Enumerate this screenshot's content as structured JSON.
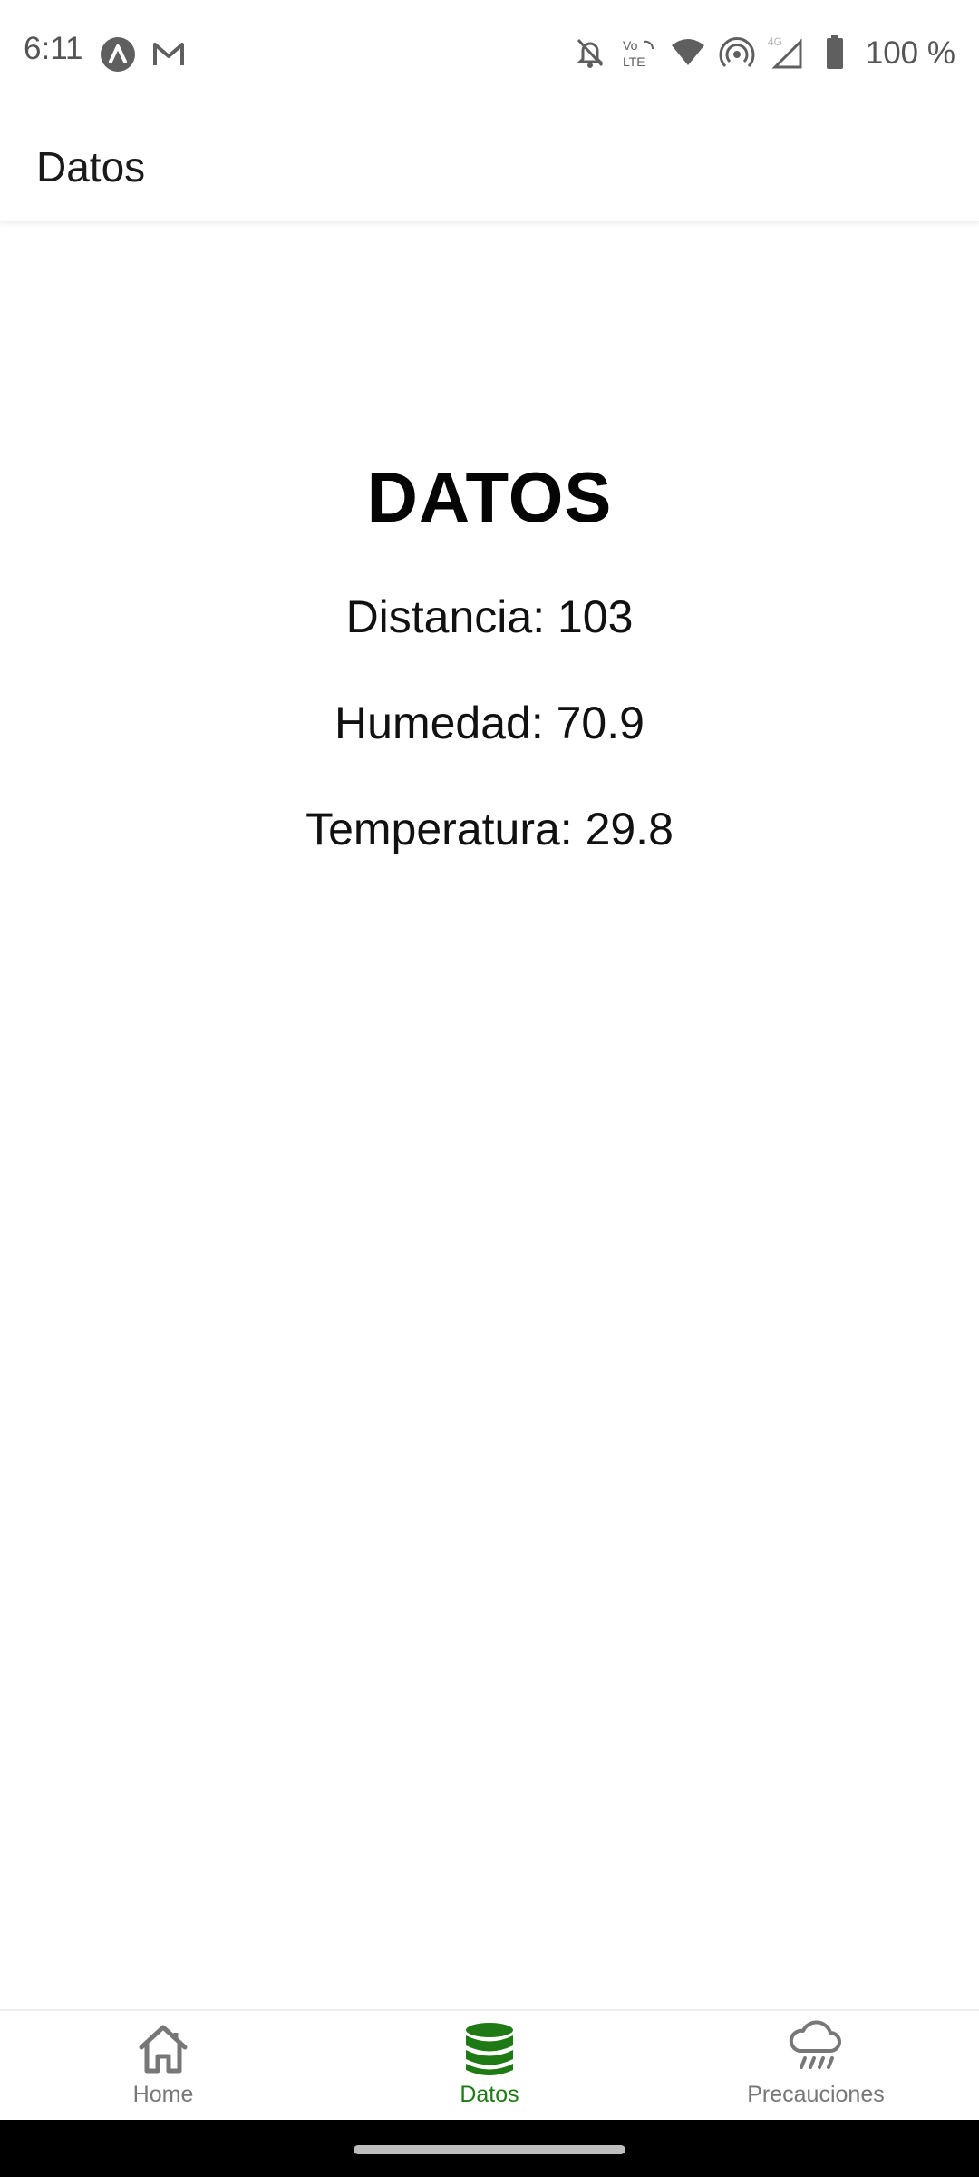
{
  "status_bar": {
    "time": "6:11",
    "battery_text": "100 %",
    "network_label": "4G",
    "volte_label": "Vo LTE",
    "left_icons": [
      "android-app-icon",
      "gmail-icon"
    ],
    "right_icons": [
      "bell-off-icon",
      "volte-icon",
      "wifi-icon",
      "hotspot-icon",
      "signal-icon",
      "battery-icon"
    ]
  },
  "header": {
    "title": "Datos"
  },
  "main": {
    "title": "DATOS",
    "lines": [
      "Distancia: 103",
      "Humedad: 70.9",
      "Temperatura: 29.8"
    ]
  },
  "tabs": [
    {
      "label": "Home",
      "icon": "home-icon",
      "active": false
    },
    {
      "label": "Datos",
      "icon": "database-icon",
      "active": true
    },
    {
      "label": "Precauciones",
      "icon": "rain-cloud-icon",
      "active": false
    }
  ],
  "colors": {
    "active_tab": "#1f7a15",
    "inactive_tab": "#777777",
    "background": "#ffffff",
    "nav_bar": "#000000"
  }
}
